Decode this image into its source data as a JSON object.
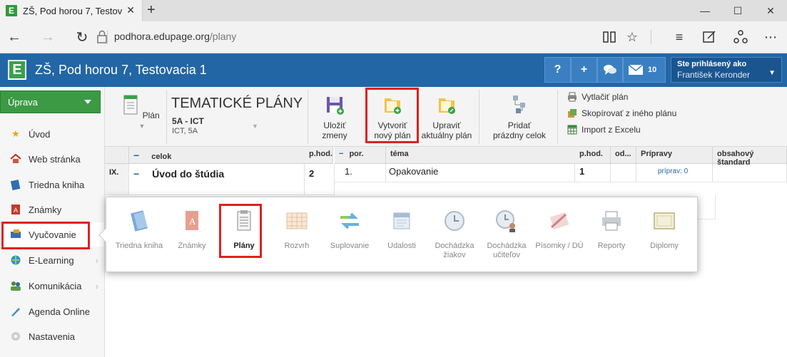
{
  "browser": {
    "tab_title": "ZŠ, Pod horou 7, Testov:",
    "url_domain": "podhora.edupage.org",
    "url_path": "/plany"
  },
  "app": {
    "title": "ZŠ, Pod horou 7, Testovacia 1",
    "help": "?",
    "plus": "+",
    "message_count": "10",
    "user_label": "Ste prihlásený ako",
    "user_name": "František Keronder"
  },
  "sidebar": {
    "uprava": "Úprava",
    "items": [
      {
        "label": "Úvod"
      },
      {
        "label": "Web stránka"
      },
      {
        "label": "Triedna kniha"
      },
      {
        "label": "Známky"
      },
      {
        "label": "Vyučovanie"
      },
      {
        "label": "E-Learning"
      },
      {
        "label": "Komunikácia"
      },
      {
        "label": "Agenda Online"
      },
      {
        "label": "Nastavenia"
      }
    ]
  },
  "toolbar": {
    "plan_label": "Plán",
    "title": "TEMATICKÉ PLÁNY",
    "class_name": "5A - ICT",
    "class_sub": "ICT, 5A",
    "save": [
      "Uložiť",
      "zmeny"
    ],
    "create": [
      "Vytvoriť",
      "nový plán"
    ],
    "edit": [
      "Upraviť",
      "aktuálny plán"
    ],
    "add_empty": [
      "Pridať",
      "prázdny celok"
    ],
    "print": "Vytlačiť plán",
    "copy": "Skopírovať z iného plánu",
    "import": "Import z Excelu"
  },
  "table": {
    "headers": {
      "minus": "−",
      "celok": "celok",
      "phod": "p.hod.",
      "por": "por.",
      "tema": "téma",
      "phod2": "p.hod.",
      "od": "od...",
      "pripravy": "Prípravy",
      "standard": "obsahový štandard"
    },
    "row": {
      "num": "IX.",
      "celok": "Úvod do štúdia",
      "phod": "2",
      "por": "1.",
      "tema": "Opakovanie",
      "phod2": "1",
      "priprav": "príprav: 0"
    }
  },
  "popup": {
    "items": [
      {
        "label": "Triedna kniha"
      },
      {
        "label": "Známky"
      },
      {
        "label": "Plány"
      },
      {
        "label": "Rozvrh"
      },
      {
        "label": "Suplovanie"
      },
      {
        "label": "Udalosti"
      },
      {
        "label": "Dochádzka žiakov"
      },
      {
        "label": "Dochádzka učiteľov"
      },
      {
        "label": "Písomky / DÚ"
      },
      {
        "label": "Reporty"
      },
      {
        "label": "Diplomy"
      }
    ]
  }
}
